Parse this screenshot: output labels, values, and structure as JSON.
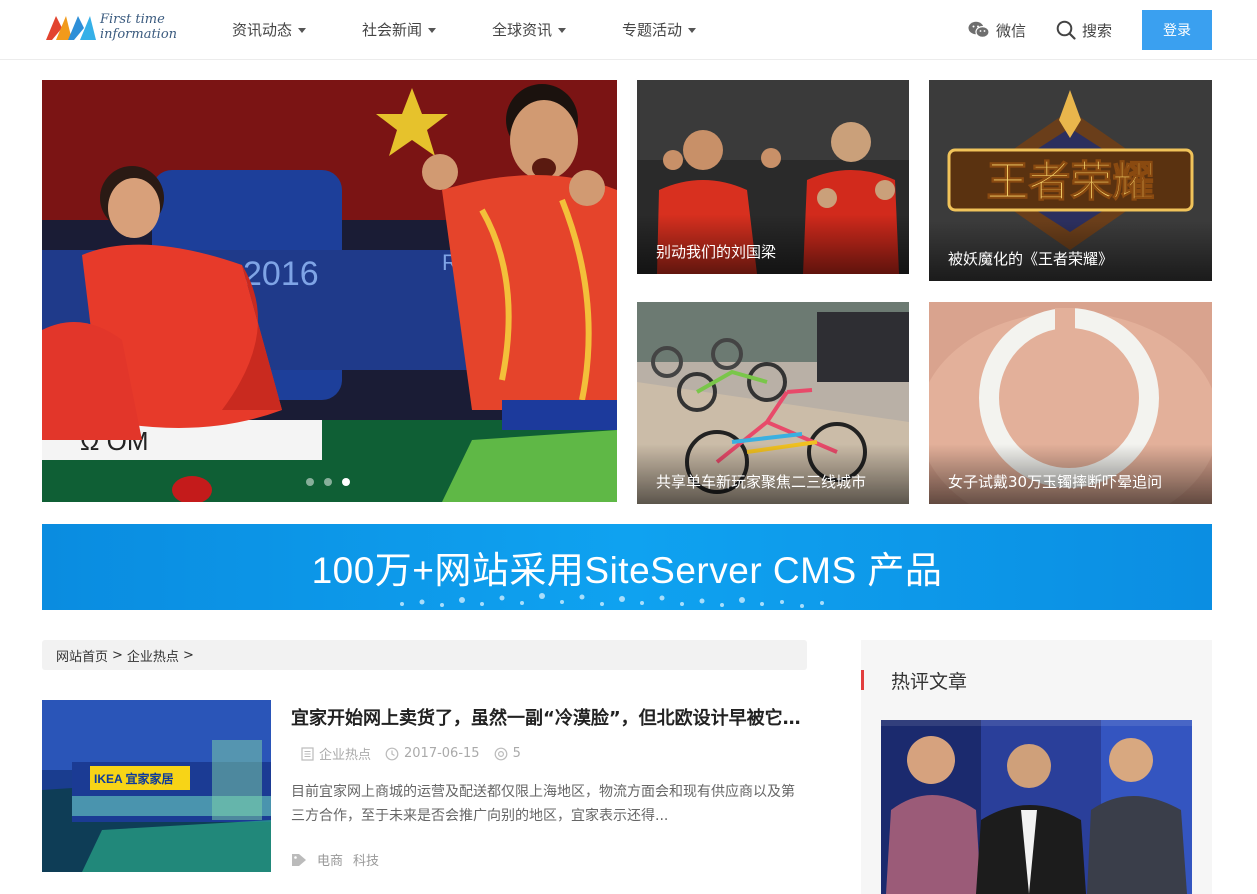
{
  "header": {
    "logo_text": "First time\ninformation",
    "nav": [
      {
        "label": "资讯动态"
      },
      {
        "label": "社会新闻"
      },
      {
        "label": "全球资讯"
      },
      {
        "label": "专题活动"
      }
    ],
    "wechat_label": "微信",
    "search_label": "搜索",
    "login_label": "登录"
  },
  "hero": {
    "slide_count": 3,
    "active_slide": 3,
    "tiles": [
      {
        "caption": "别动我们的刘国梁"
      },
      {
        "caption": "被妖魔化的《王者荣耀》",
        "image_text": "王者荣耀"
      },
      {
        "caption": "共享单车新玩家聚焦二三线城市"
      },
      {
        "caption": "女子试戴30万玉镯摔断吓晕追问"
      }
    ]
  },
  "banner": {
    "text": "100万+网站采用SiteServer CMS 产品"
  },
  "breadcrumb": {
    "items": [
      "网站首页",
      ">",
      "企业热点",
      ">"
    ]
  },
  "article": {
    "title": "宜家开始网上卖货了，虽然一副“冷漠脸”，但北欧设计早被它抄烂了",
    "category": "企业热点",
    "date": "2017-06-15",
    "views": "5",
    "excerpt": "目前宜家网上商城的运营及配送都仅限上海地区，物流方面会和现有供应商以及第三方合作，至于未来是否会推广向别的地区，宜家表示还得...",
    "tags": [
      "电商",
      "科技"
    ],
    "thumb_sign": "IKEA 宜家家居"
  },
  "sidebar": {
    "title": "热评文章"
  },
  "colors": {
    "accent": "#3aa0f0",
    "banner": "#0f9ae8",
    "sidebar_bar": "#e23e3e"
  }
}
